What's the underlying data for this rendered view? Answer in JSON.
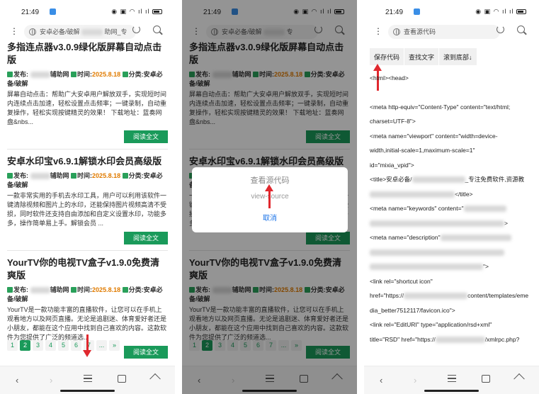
{
  "status": {
    "time": "21:49"
  },
  "panel1": {
    "url": "安卓必备/破解",
    "url_tail": "助网_专",
    "articles": [
      {
        "title": "多指连点器v3.0.9绿化版屏幕自动点击版",
        "publish_label": "发布:",
        "site_suffix": "辅助网",
        "time_label": "时间:",
        "date": "2025.8.18",
        "category_label": "分类:",
        "category": "安卓必备/破解",
        "excerpt": "屏幕自动点击：帮助广大安卓用户解放双手，实现短时间内连续点击加速，轻松设置点击频率；一键录制，自动重复操作，轻松实现按键精灵的效果！ 下载地址：蓝奏网盘&nbs...",
        "read_more": "阅读全文"
      },
      {
        "title": "安卓水印宝v6.9.1解锁水印会员高级版",
        "publish_label": "发布:",
        "site_suffix": "辅助网",
        "time_label": "时间:",
        "date": "2025.8.18",
        "category_label": "分类:",
        "category": "安卓必备/破解",
        "excerpt": "一款非常实用的手机去水印工具，用户可以利用该软件一键清除视频和图片上的水印，还能保持图片视频高清不受损，同时软件还支持自由添加和自定义设置水印，功能多多，操作简单易上手。解锁会员 ...",
        "read_more": "阅读全文"
      },
      {
        "title": "YourTV你的电视TV盒子v1.9.0免费清爽版",
        "publish_label": "发布:",
        "site_suffix": "辅助网",
        "time_label": "时间:",
        "date": "2025.8.18",
        "category_label": "分类:",
        "category": "安卓必备/破解",
        "excerpt": "YourTV是一款功能丰富的直播软件，让您可以在手机上观看地方以及网页直播。无论是追剧迷、体育爱好者还是小朋友，都能在这个应用中找到自己喜欢的内容。这款软件为您提供了广泛的频道选...",
        "read_more": "阅读全文"
      }
    ],
    "pager": [
      "1",
      "2",
      "3",
      "4",
      "5",
      "6",
      "7",
      "...",
      "»"
    ]
  },
  "panel2": {
    "url": "安卓必备/破解",
    "url_tail": "专",
    "dialog": {
      "title": "查看源代码",
      "subtitle": "view-source",
      "cancel": "取消"
    }
  },
  "panel3": {
    "url": "查看源代码",
    "toolbar": [
      "保存代码",
      "查找文字",
      "滚到底部↓"
    ],
    "source_lines": [
      "<html><head>",
      "",
      "<meta http-equiv=\"Content-Type\" content=\"text/html;",
      "charset=UTF-8\">",
      "<meta name=\"viewport\" content=\"width=device-",
      "width,initial-scale=1,maximum-scale=1\"",
      "id=\"mixia_vpid\">",
      "<title>安卓必备/",
      "</title>",
      "<meta name=\"keywords\" content=\"",
      ">",
      "<meta name=\"description\"",
      "\">",
      "<link rel=\"shortcut icon\"",
      "href=\"https://",
      "dia_better7512117/favicon.ico\">",
      "<link rel=\"EditURI\" type=\"application/rsd+xml\"",
      "title=\"RSD\" href=\"https://"
    ],
    "source_tails": {
      "title": "_专注免费软件,资源教",
      "favicon": "content/templates/eme",
      "rsd": "/xmlrpc.php?"
    }
  }
}
